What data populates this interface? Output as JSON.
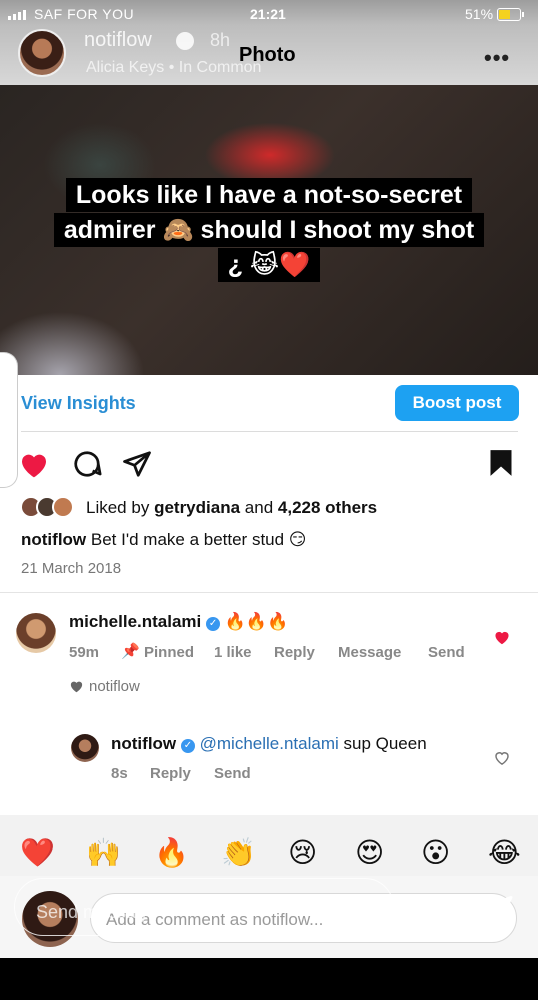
{
  "status_bar": {
    "carrier": "SAF FOR YOU",
    "time": "21:21",
    "battery": "51%",
    "battery_level": 0.51
  },
  "story": {
    "username": "notiflow",
    "time_ago": "8h",
    "music": "Alicia Keys • In Common",
    "caption_lines": [
      "Looks like I have a not-so-secret",
      "admirer 🙈 should I shoot my shot",
      "¿ 😹❤️"
    ]
  },
  "header": {
    "title": "Photo",
    "more_label": "•••"
  },
  "insights": {
    "view_insights": "View Insights",
    "boost_post": "Boost post"
  },
  "colors": {
    "accent": "#1da1f2",
    "like_red": "#ed1944",
    "verified_blue": "#3897f0"
  },
  "likes": {
    "prefix": "Liked by",
    "user": "getrydiana",
    "and": "and",
    "others": "4,228 others"
  },
  "post": {
    "username": "notiflow",
    "caption": "Bet I'd make a better stud 😏",
    "date": "21 March 2018"
  },
  "comments": [
    {
      "username": "michelle.ntalami",
      "text": "🔥🔥🔥",
      "time": "59m",
      "pinned": "Pinned",
      "likes": "1 like",
      "reply": "Reply",
      "message": "Message",
      "send": "Send",
      "liked_by": "notiflow",
      "liked": true
    },
    {
      "username": "notiflow",
      "mention": "@michelle.ntalami",
      "text": "sup Queen",
      "time": "8s",
      "reply": "Reply",
      "send": "Send",
      "liked": false
    }
  ],
  "emoji_bar": [
    "❤️",
    "🙌",
    "🔥",
    "👏",
    "😢",
    "😍",
    "😮",
    "😂"
  ],
  "composer": {
    "placeholder": "Add a comment as notiflow...",
    "story_send": "Send message"
  }
}
